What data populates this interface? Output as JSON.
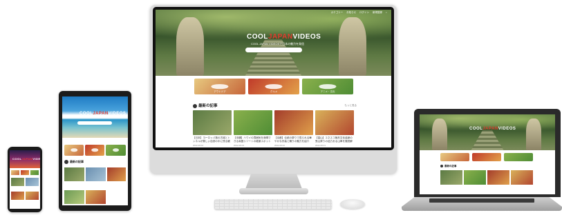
{
  "brand": {
    "cool": "COOL",
    "japan": "JAPAN",
    "videos": "VIDEOS",
    "tagline": "COOL JAPAN VIDEOSで日本の魅力を発信",
    "accent": "#e23b2e"
  },
  "nav": [
    "カテゴリー",
    "お知らせ",
    "ログイン",
    "新規登録"
  ],
  "categories": [
    {
      "label": "アウトドア",
      "icon": "tent-icon"
    },
    {
      "label": "グルメ",
      "icon": "food-icon"
    },
    {
      "label": "アニメ・文化",
      "icon": "culture-icon"
    }
  ],
  "latest": {
    "heading": "最新の記事",
    "more": "もっと見る",
    "articles": [
      {
        "title": "【日本】ヨーロッパ風の古城とトンネルが美しい自然の中に残る観光スポット",
        "date": "2022.08.04",
        "views": "1,530 views"
      },
      {
        "title": "【沖縄】ハワイの雰囲気を満喫できる南国リゾートの絶景スポット紹介",
        "date": "2022.08.03",
        "views": "1,210 views"
      },
      {
        "title": "【京都】伝統の祭りで見られる華やかな衣装と踊りの魅力を紹介",
        "date": "2022.08.02",
        "views": "980 views"
      },
      {
        "title": "【富山】ユネスコ無形文化遺産の曳山祭りの迫力ある山車を徹底解説",
        "date": "2022.08.01",
        "views": "860 views"
      }
    ]
  }
}
